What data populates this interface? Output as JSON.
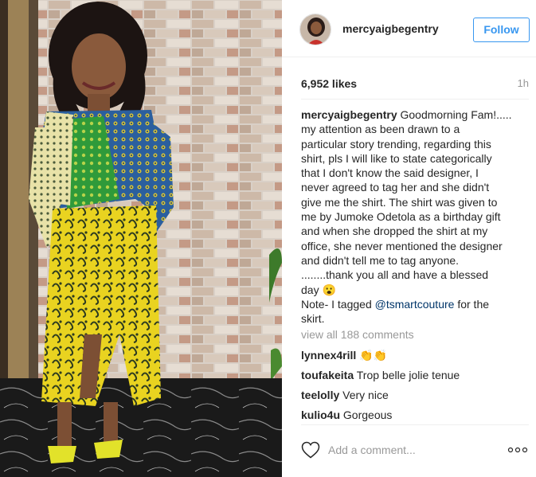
{
  "post": {
    "username": "mercyaigbegentry",
    "follow_label": "Follow",
    "likes": "6,952 likes",
    "time": "1h",
    "caption_user": "mercyaigbegentry",
    "caption_lines": [
      " Goodmorning Fam!.....",
      "my attention as been drawn to a",
      "particular story trending, regarding this",
      "shirt, pls I will like to state categorically",
      "that I don't know the said designer, I",
      "never agreed to tag her and she didn't",
      "give me the shirt. The shirt was given to",
      "me by Jumoke Odetola as a birthday gift",
      "and when she dropped the shirt at my",
      "office, she never mentioned the designer",
      "and didn't tell me to tag anyone.",
      "........thank you all and have a blessed",
      "day 😮"
    ],
    "note_prefix": "Note- I tagged ",
    "note_mention": "@tsmartcouture",
    "note_suffix": " for the",
    "note_end": "skirt.",
    "view_all": "view all 188 comments",
    "comments": [
      {
        "user": "lynnex4rill",
        "text": "👏👏"
      },
      {
        "user": "toufakeita",
        "text": "Trop belle jolie tenue"
      },
      {
        "user": "teelolly",
        "text": "Very nice"
      },
      {
        "user": "kulio4u",
        "text": "Gorgeous"
      }
    ],
    "add_comment_placeholder": "Add a comment...",
    "colors": {
      "follow_blue": "#3897f0",
      "mention": "#003569",
      "muted": "#999999"
    }
  }
}
